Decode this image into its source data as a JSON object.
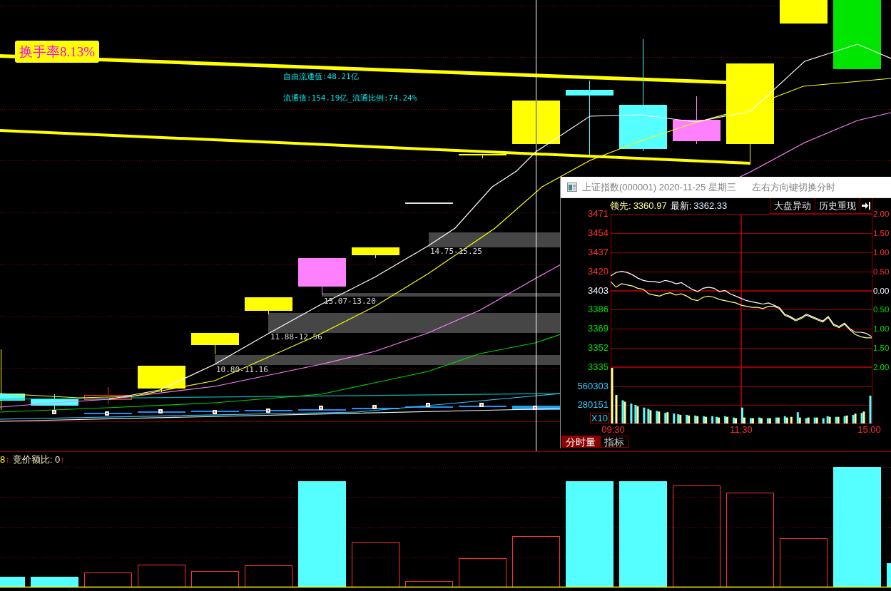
{
  "kline_chart": {
    "turnover_badge": "换手率8.13%",
    "float_values": [
      "自由流通值:48.21亿",
      "流通值:154.19亿_流通比例:74.24%"
    ],
    "price_zones": [
      {
        "label": "14.75-15.25"
      },
      {
        "label": "13.07-13.20"
      },
      {
        "label": "11.88-12.56"
      },
      {
        "label": "10.80-11.16"
      }
    ]
  },
  "indicator_pane": {
    "legend": [
      {
        "kind": "value",
        "text": "8"
      },
      {
        "kind": "arrow",
        "text": "↑"
      },
      {
        "kind": "label",
        "text": "竞价额比: 0"
      },
      {
        "kind": "arrow",
        "text": "↑"
      }
    ]
  },
  "intraday_window": {
    "title": "上证指数(000001) 2020-11-25 星期三",
    "hint": "左右方向键切换分时",
    "quote": [
      {
        "kind": "lead",
        "label": "领先:",
        "value": "3360.97"
      },
      {
        "kind": "latest",
        "label": "最新:",
        "value": "3362.33"
      }
    ],
    "buttons": [
      {
        "label": "大盘异动"
      },
      {
        "label": "历史重现"
      }
    ],
    "price_chart": {
      "chart_data": {
        "type": "line",
        "grid": true,
        "categories": [
          null,
          null,
          null,
          null,
          null,
          null,
          null,
          null,
          null,
          null,
          null,
          null,
          null,
          null,
          null,
          null,
          null,
          null,
          null,
          null,
          null,
          null,
          null,
          null,
          null,
          null,
          null,
          null,
          null,
          null,
          null,
          null,
          null,
          null,
          null,
          null,
          null,
          null,
          null,
          null,
          null,
          null,
          null,
          null,
          null,
          null,
          null,
          null,
          null
        ],
        "series": [
          {
            "color": "#ffffff",
            "values": [
              3416,
              3419,
              3420,
              3419,
              3417,
              3414,
              3412,
              3411,
              3411,
              3410,
              3412,
              3411,
              3409,
              3410,
              3407,
              3404,
              3402,
              3405,
              3406,
              3405,
              3402,
              3403,
              3400,
              3398,
              3396,
              3394,
              3393,
              3392,
              3391,
              3392,
              3390,
              3388,
              3382,
              3380,
              3377,
              3379,
              3382,
              3380,
              3378,
              3376,
              3380,
              3373,
              3371,
              3374,
              3369,
              3366,
              3366,
              3365,
              3362
            ]
          },
          {
            "color": "#ffff80",
            "values": [
              3411,
              3406,
              3409,
              3408,
              3407,
              3405,
              3404,
              3400,
              3399,
              3398,
              3400,
              3401,
              3399,
              3400,
              3398,
              3395,
              3394,
              3397,
              3398,
              3397,
              3395,
              3394,
              3393,
              3392,
              3390,
              3389,
              3388,
              3388,
              3387,
              3389,
              3389,
              3387,
              3381,
              3379,
              3376,
              3378,
              3381,
              3379,
              3377,
              3375,
              3379,
              3372,
              3370,
              3373,
              3368,
              3364,
              3362,
              3361,
              3361
            ]
          }
        ],
        "ylim": [
          3335,
          3471
        ],
        "yticks": [
          {
            "value": 3471,
            "label": "3471"
          },
          {
            "value": 3454,
            "label": "3454"
          },
          {
            "value": 3437,
            "label": "3437"
          },
          {
            "value": 3420,
            "label": "3420"
          },
          {
            "value": 3403,
            "label": "3403"
          },
          {
            "value": 3386,
            "label": "3386"
          },
          {
            "value": 3369,
            "label": "3369"
          },
          {
            "value": 3352,
            "label": "3352"
          },
          {
            "value": 3335,
            "label": "3335"
          }
        ]
      }
    },
    "percent_axis": [
      {
        "label": "2.00",
        "kind": "up"
      },
      {
        "label": "1.50",
        "kind": "up"
      },
      {
        "label": "1.00",
        "kind": "up"
      },
      {
        "label": "0.50",
        "kind": "up"
      },
      {
        "label": "0.00",
        "kind": "flat"
      },
      {
        "label": "0.50",
        "kind": "down"
      },
      {
        "label": "1.00",
        "kind": "down"
      },
      {
        "label": "1.50",
        "kind": "down"
      },
      {
        "label": "2.00",
        "kind": "down"
      }
    ],
    "volume_chart": {
      "multiplier": "X10",
      "chart_data": {
        "type": "bar",
        "grid": true,
        "categories": [
          "09:30",
          null,
          null,
          null,
          null,
          null,
          null,
          null,
          null,
          null,
          null,
          null,
          null,
          null,
          null,
          null,
          null,
          null,
          null,
          null,
          null,
          null,
          null,
          null,
          null,
          null,
          null,
          null,
          null,
          null,
          "11:30",
          null,
          null,
          null,
          null,
          null,
          null,
          null,
          null,
          null,
          null,
          null,
          null,
          null,
          null,
          null,
          null,
          null,
          null,
          null,
          null,
          null,
          null,
          null,
          null,
          null,
          null,
          null,
          null,
          null,
          "15:00"
        ],
        "series": [
          {
            "color": "#ffff99",
            "values": [
              840000,
              430000,
              null,
              330000,
              null,
              null,
              260000,
              null,
              null,
              200000,
              null,
              180000,
              null,
              170000,
              null,
              null,
              130000,
              null,
              120000,
              null,
              110000,
              null,
              100000,
              null,
              null,
              90000,
              null,
              100000,
              null,
              80000,
              null,
              90000,
              null,
              80000,
              null,
              80000,
              null,
              80000,
              null,
              90000,
              null,
              90000,
              100000,
              null,
              90000,
              null,
              90000,
              null,
              90000,
              null,
              null,
              100000,
              null,
              100000,
              null,
              120000,
              null,
              150000,
              null,
              180000,
              null
            ]
          },
          {
            "color": "#55ffff",
            "values": [
              null,
              null,
              350000,
              null,
              300000,
              280000,
              null,
              240000,
              220000,
              null,
              190000,
              null,
              160000,
              null,
              150000,
              140000,
              null,
              130000,
              null,
              120000,
              null,
              110000,
              null,
              110000,
              100000,
              null,
              110000,
              null,
              90000,
              null,
              240000,
              null,
              80000,
              null,
              90000,
              null,
              80000,
              null,
              90000,
              null,
              110000,
              null,
              null,
              170000,
              null,
              80000,
              null,
              90000,
              null,
              80000,
              110000,
              null,
              100000,
              null,
              110000,
              null,
              130000,
              null,
              160000,
              null,
              420000
            ]
          }
        ],
        "ylim": [
          0,
          840454
        ],
        "yticks": [
          {
            "value": 280151,
            "label": "280151"
          },
          {
            "value": 560303,
            "label": "560303"
          }
        ]
      }
    },
    "tabs": [
      {
        "label": "分时量",
        "selected": true
      },
      {
        "label": "指标",
        "selected": false
      }
    ]
  }
}
